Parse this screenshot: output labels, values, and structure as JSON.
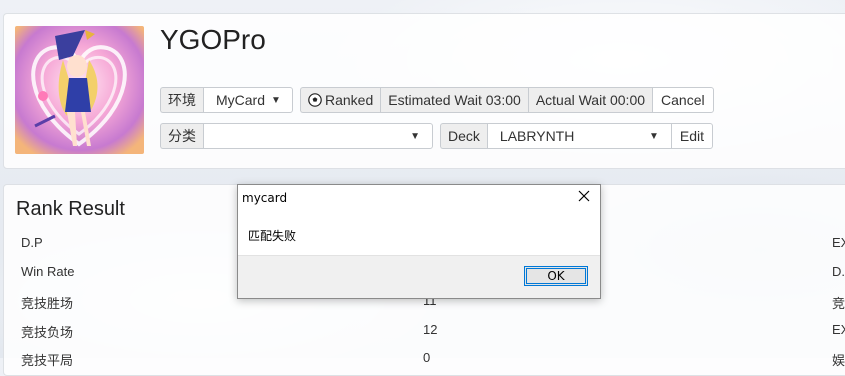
{
  "app": {
    "title": "YGOPro"
  },
  "row1": {
    "env_label": "环境",
    "env_value": "MyCard",
    "ranked_label": "Ranked",
    "estimated_wait": "Estimated Wait 03:00",
    "actual_wait": "Actual Wait 00:00",
    "cancel_label": "Cancel"
  },
  "row2": {
    "category_label": "分类",
    "category_value": "",
    "deck_label": "Deck",
    "deck_value": "LABRYNTH",
    "edit_label": "Edit"
  },
  "rank": {
    "title": "Rank Result",
    "rows": [
      {
        "label": "D.P",
        "value": "",
        "right": "EX"
      },
      {
        "label": "Win Rate",
        "value": "",
        "right": "D."
      },
      {
        "label": "竞技胜场",
        "value": "11",
        "right": "竞"
      },
      {
        "label": "竞技负场",
        "value": "12",
        "right": "EX"
      },
      {
        "label": "竞技平局",
        "value": "0",
        "right": "娱"
      }
    ]
  },
  "dialog": {
    "title": "mycard",
    "message": "匹配失败",
    "ok_label": "OK"
  }
}
